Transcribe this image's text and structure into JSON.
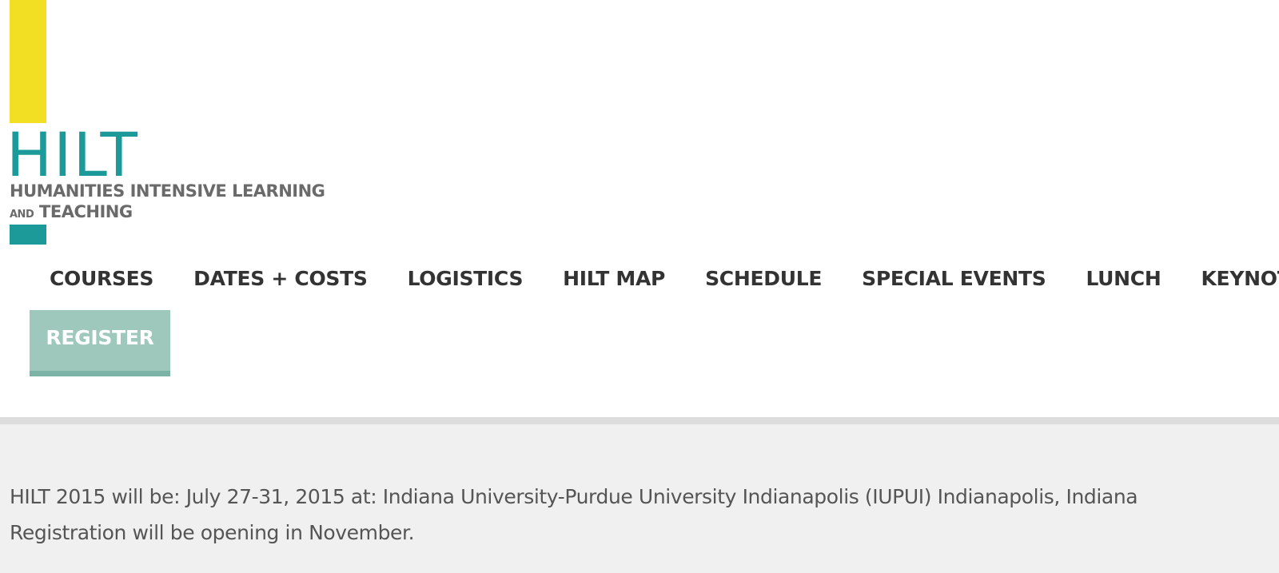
{
  "colors": {
    "yellow": "#f2de22",
    "teal": "#1b9a99",
    "register_bg": "#9dc8bb",
    "register_border": "#7bb4a6"
  },
  "logo": {
    "word": "HILT",
    "line1": "HUMANITIES INTENSIVE LEARNING",
    "line2_small": "AND",
    "line2": "TEACHING"
  },
  "nav": {
    "items": [
      {
        "label": "COURSES"
      },
      {
        "label": "DATES + COSTS"
      },
      {
        "label": "LOGISTICS"
      },
      {
        "label": "HILT MAP"
      },
      {
        "label": "SCHEDULE"
      },
      {
        "label": "SPECIAL EVENTS"
      },
      {
        "label": "LUNCH"
      },
      {
        "label": "KEYNOTE"
      }
    ],
    "register_label": "REGISTER"
  },
  "content": {
    "line1": "HILT 2015 will be: July 27-31, 2015 at: Indiana University-Purdue University Indianapolis (IUPUI) Indianapolis, Indiana",
    "line2": "Registration will be opening in November."
  }
}
